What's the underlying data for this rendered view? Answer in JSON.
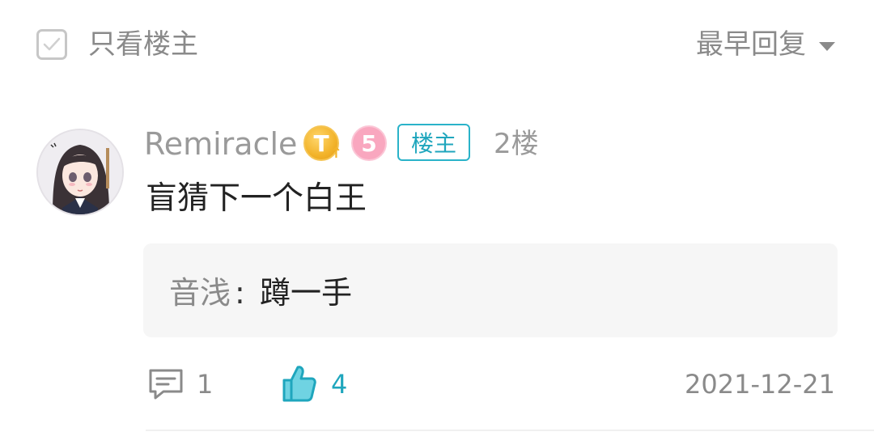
{
  "filter": {
    "only_op_label": "只看楼主",
    "sort_label": "最早回复"
  },
  "post": {
    "username": "Remiracle",
    "level_badge": "T",
    "rank_badge": "5",
    "op_tag": "楼主",
    "floor": "2楼",
    "content": "盲猜下一个白王",
    "reply": {
      "author": "音浅",
      "separator": ":",
      "text": "蹲一手"
    },
    "comment_count": "1",
    "like_count": "4",
    "date": "2021-12-21"
  },
  "colors": {
    "accent": "#1fa6bd",
    "muted_text": "#8a8a8a",
    "reply_bg": "#f6f6f6",
    "level_gold": "#f2b32a",
    "rank_pink": "#f9a7bf"
  },
  "icons": {
    "checkbox": "checkbox-icon",
    "sort": "chevron-down-icon",
    "comment": "comment-icon",
    "like": "thumbs-up-icon"
  }
}
